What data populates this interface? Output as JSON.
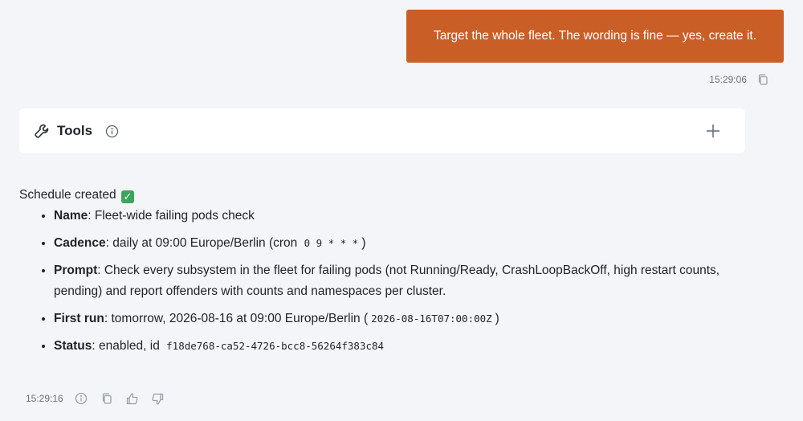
{
  "user_message": {
    "text": "Target the whole fleet. The wording is fine — yes, create it.",
    "timestamp": "15:29:06",
    "bubble_color": "#c95f27"
  },
  "tools_card": {
    "title": "Tools",
    "info_icon": "info-icon",
    "tool_icon": "wrench-icon",
    "expand_icon": "plus-icon"
  },
  "assistant_message": {
    "headline": "Schedule created",
    "items": [
      {
        "label": "Name",
        "text": ": Fleet-wide failing pods check"
      },
      {
        "label": "Cadence",
        "text": ": daily at 09:00 Europe/Berlin (cron ",
        "code": "0 9 * * *",
        "suffix": ")"
      },
      {
        "label": "Prompt",
        "text": ": Check every subsystem in the fleet for failing pods (not Running/Ready, CrashLoopBackOff, high restart counts, pending) and report offenders with counts and namespaces per cluster."
      },
      {
        "label": "First run",
        "text": ": tomorrow, 2026-08-16 at 09:00 Europe/Berlin (",
        "code": "2026-08-16T07:00:00Z",
        "suffix": ")"
      },
      {
        "label": "Status",
        "text": ": enabled, id ",
        "code": "f18de768-ca52-4726-bcc8-56264f383c84"
      }
    ],
    "timestamp": "15:29:16"
  }
}
